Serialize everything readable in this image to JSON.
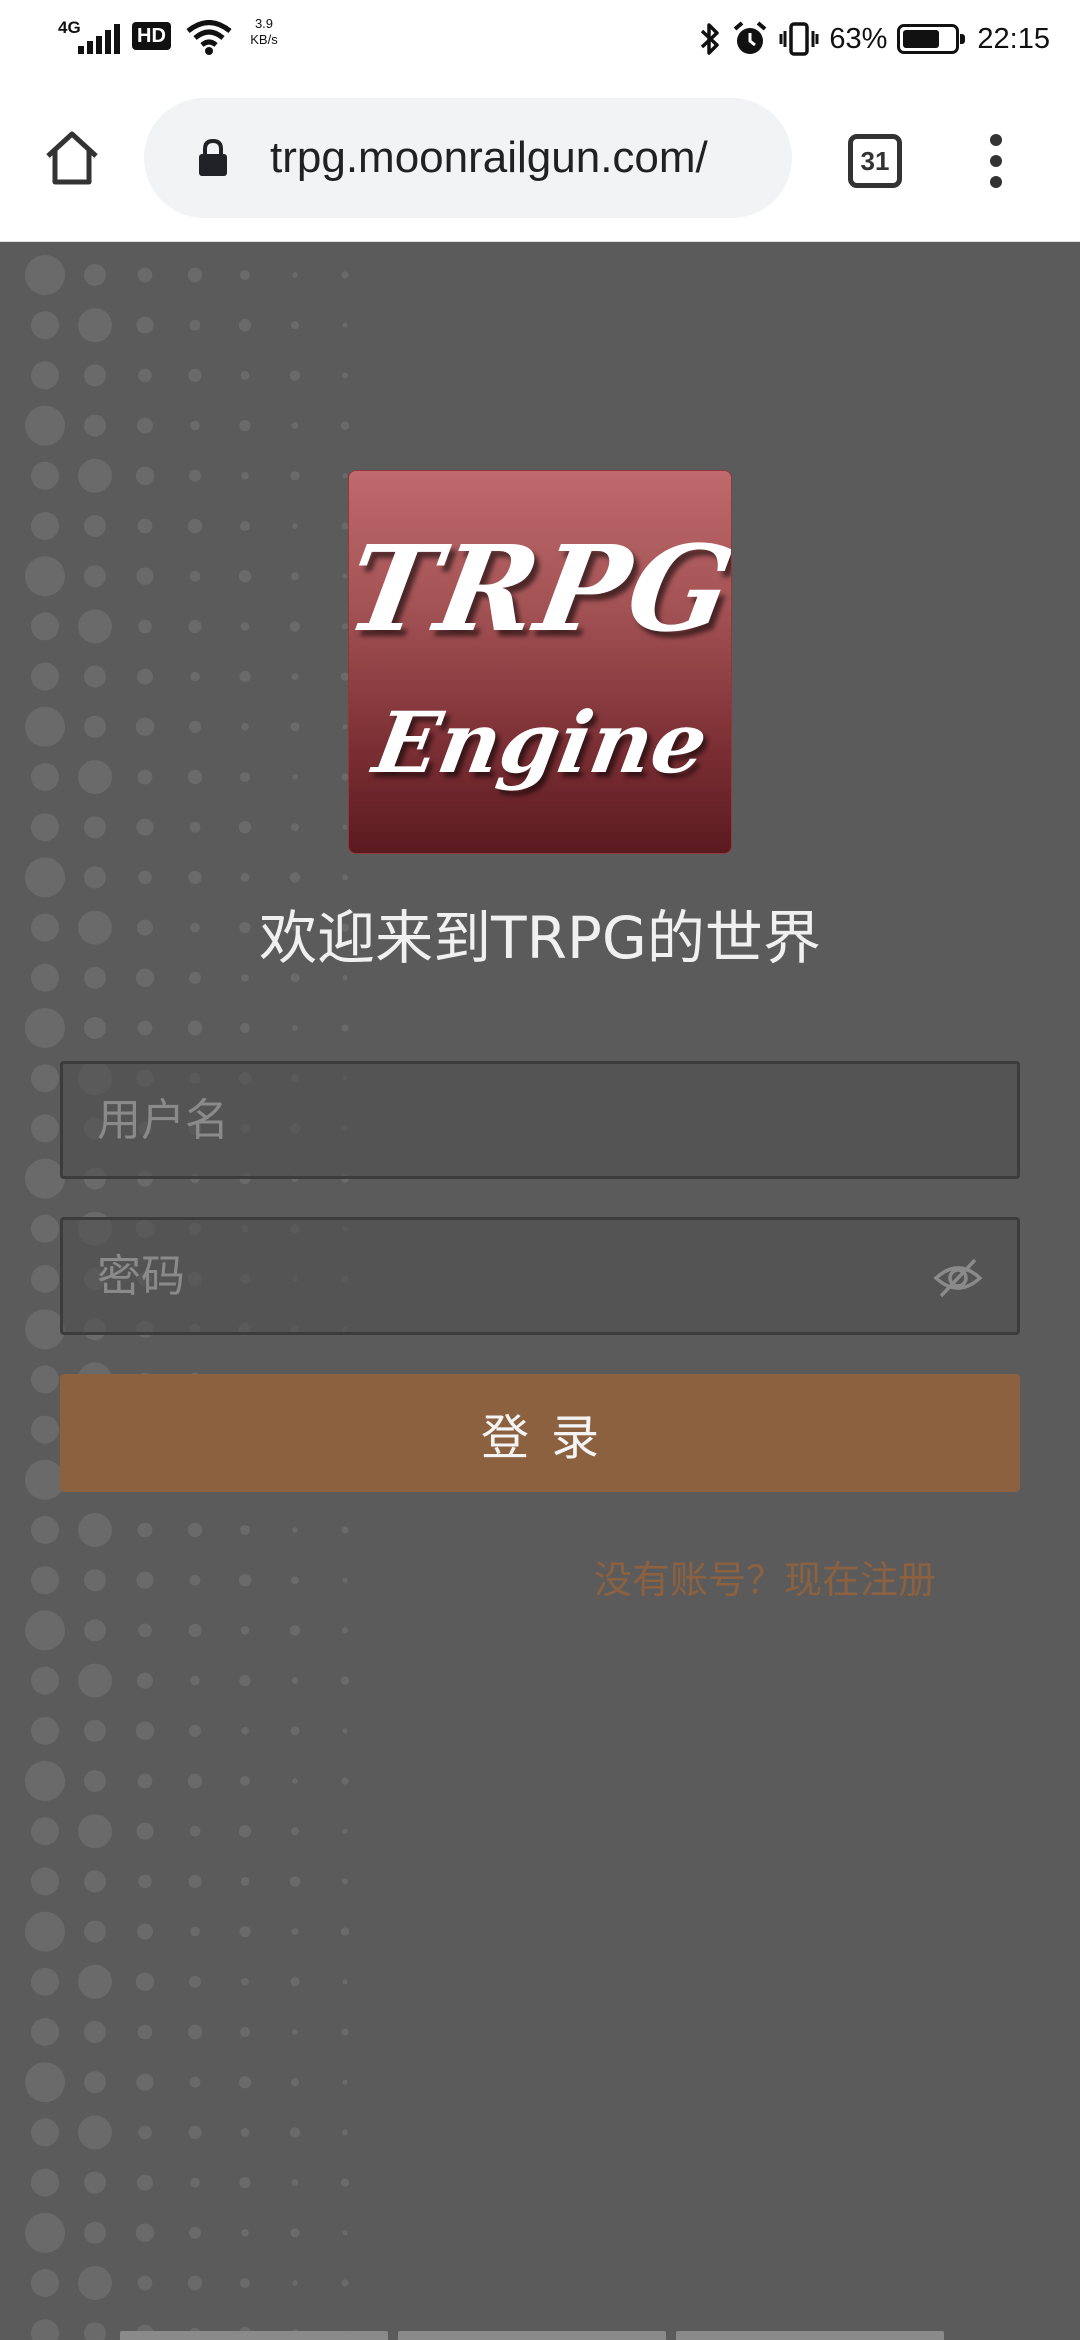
{
  "status_bar": {
    "network": "4G",
    "hd": "HD",
    "speed_value": "3.9",
    "speed_unit": "KB/s",
    "battery_percent": "63%",
    "battery_level": 0.63,
    "time": "22:15",
    "icons": [
      "signal-icon",
      "wifi-icon",
      "bluetooth-icon",
      "alarm-icon",
      "vibrate-icon",
      "battery-icon"
    ]
  },
  "browser": {
    "url": "trpg.moonrailgun.com/",
    "tab_count": "31",
    "icons": [
      "home-icon",
      "lock-icon",
      "tabs-icon",
      "more-vert-icon"
    ]
  },
  "page": {
    "logo": {
      "line1": "TRPG",
      "line2": "Engine"
    },
    "welcome": "欢迎来到TRPG的世界",
    "username_placeholder": "用户名",
    "password_placeholder": "密码",
    "login_label": "登录",
    "register_link": "没有账号？现在注册"
  },
  "colors": {
    "background": "#5b5b5b",
    "accent": "#8c6140",
    "logo_top": "#bf6a6c",
    "logo_bottom": "#5a1a1f"
  }
}
